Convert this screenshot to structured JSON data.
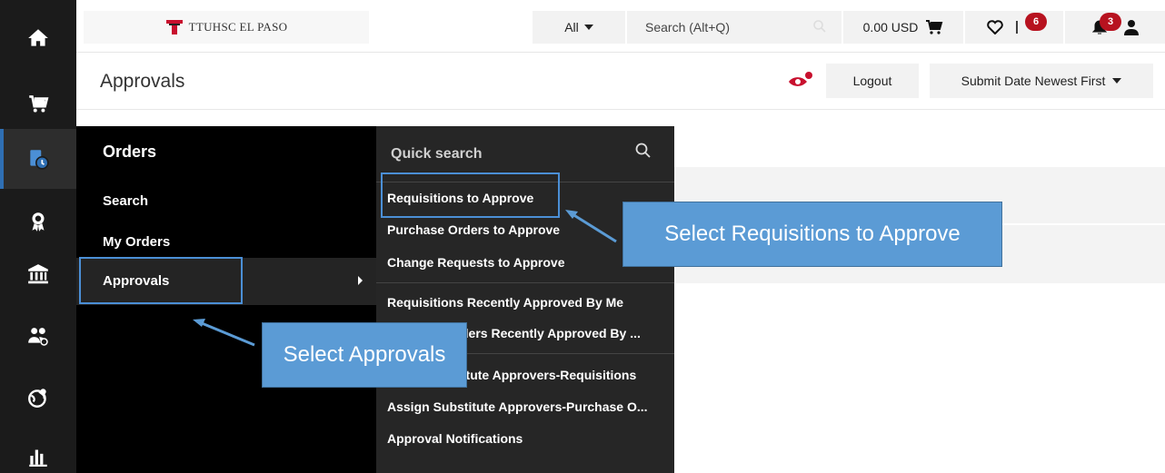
{
  "topbar": {
    "logo_text": "TTUHSC EL PASO",
    "scope_label": "All",
    "search_placeholder": "Search (Alt+Q)",
    "cart_total": "0.00 USD",
    "favorites_badge": "6",
    "notifications_badge": "3"
  },
  "header": {
    "title": "Approvals",
    "logout_label": "Logout",
    "sort_label": "Submit Date Newest First"
  },
  "menu": {
    "title": "Orders",
    "items": [
      {
        "label": "Search"
      },
      {
        "label": "My Orders"
      },
      {
        "label": "Approvals"
      }
    ]
  },
  "submenu": {
    "quick_search_placeholder": "Quick search",
    "items": [
      {
        "label": "Requisitions to Approve"
      },
      {
        "label": "Purchase Orders to Approve"
      },
      {
        "label": "Change Requests to Approve"
      },
      {
        "label": "Requisitions Recently Approved By Me"
      },
      {
        "label": "ders Recently Approved By ..."
      },
      {
        "label": "titute Approvers-Requisitions"
      },
      {
        "label": "Assign Substitute Approvers-Purchase O..."
      },
      {
        "label": "Approval Notifications"
      }
    ]
  },
  "callouts": {
    "requisitions": "Select Requisitions to Approve",
    "approvals": "Select Approvals"
  },
  "colors": {
    "rail": "#1b1b1b",
    "menu_bg": "#000000",
    "submenu_bg": "#262626",
    "accent": "#2f6fb3",
    "callout": "#5b9bd5",
    "badge": "#b7121f"
  }
}
